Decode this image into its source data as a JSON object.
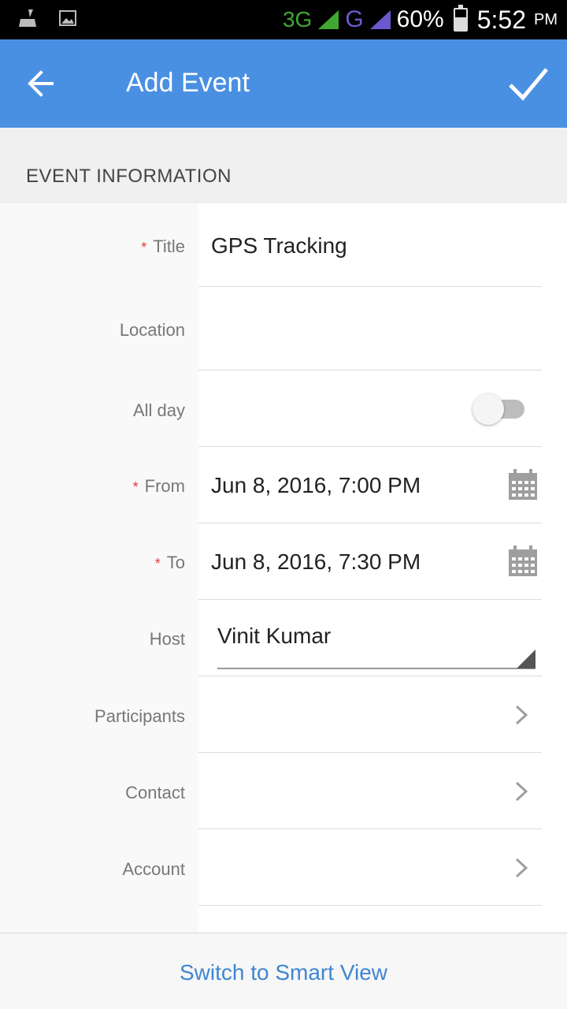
{
  "status_bar": {
    "network_3g": "3G",
    "network_g": "G",
    "battery": "60%",
    "battery_level": 0.6,
    "time": "5:52",
    "ampm": "PM",
    "icons": [
      "cleaner-icon",
      "image-icon",
      "signal-icon",
      "battery-icon"
    ]
  },
  "app_bar": {
    "title": "Add Event",
    "back_icon": "arrow-left-icon",
    "done_icon": "check-icon",
    "color": "#4a90e2"
  },
  "section": {
    "title": "EVENT INFORMATION"
  },
  "form": {
    "title": {
      "label": "Title",
      "required": "*",
      "value": "GPS Tracking"
    },
    "location": {
      "label": "Location",
      "value": ""
    },
    "all_day": {
      "label": "All day",
      "on": false
    },
    "from": {
      "label": "From",
      "required": "*",
      "value": "Jun 8, 2016, 7:00 PM"
    },
    "to": {
      "label": "To",
      "required": "*",
      "value": "Jun 8, 2016, 7:30 PM"
    },
    "host": {
      "label": "Host",
      "value": "Vinit Kumar"
    },
    "participants": {
      "label": "Participants"
    },
    "contact": {
      "label": "Contact"
    },
    "account": {
      "label": "Account"
    }
  },
  "bottom": {
    "link": "Switch to Smart View",
    "link_color": "#3f86d0"
  }
}
